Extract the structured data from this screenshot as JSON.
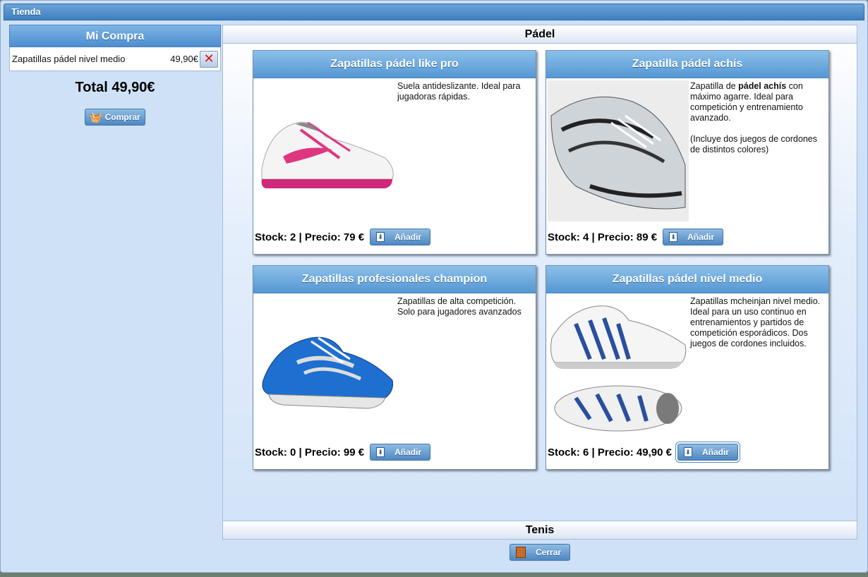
{
  "window": {
    "title": "Tienda"
  },
  "cart": {
    "header": "Mi Compra",
    "items": [
      {
        "name": "Zapatillas pádel nivel medio",
        "price": "49,90€"
      }
    ],
    "total": "Total 49,90€",
    "buy_label": "Comprar"
  },
  "sections": {
    "padel": "Pádel",
    "tenis": "Tenis"
  },
  "products": [
    {
      "title": "Zapatillas pádel like pro",
      "description": "Suela antideslizante. Ideal para jugadoras rápidas.",
      "footer": "Stock: 2 | Precio: 79 €",
      "add_label": "Añadir",
      "color": "#e0357f"
    },
    {
      "title": "Zapatilla pádel achís",
      "desc_prefix": "Zapatilla de ",
      "desc_bold": "pádel achís",
      "desc_suffix": " con máximo agarre. Ideal para competición y entrenamiento avanzado.",
      "desc_note": "(Incluye dos juegos de cordones de distintos colores)",
      "footer": "Stock: 4 | Precio: 89 €",
      "add_label": "Añadir",
      "color": "#333333"
    },
    {
      "title": "Zapatillas profesionales champion",
      "description": "Zapatillas de alta competición. Solo para jugadores avanzados",
      "footer": "Stock: 0 | Precio: 99 €",
      "add_label": "Añadir",
      "color": "#1e6fd0"
    },
    {
      "title": "Zapatillas pádel nivel medio",
      "description": "Zapatillas mcheinjan nivel medio. Ideal para un uso continuo en entrenamientos y partidos de competición esporádicos. Dos juegos de cordones incluidos.",
      "footer": "Stock: 6 | Precio: 49,90 €",
      "add_label": "Añadir",
      "color": "#2a4fa0"
    }
  ],
  "close_label": "Cerrar"
}
